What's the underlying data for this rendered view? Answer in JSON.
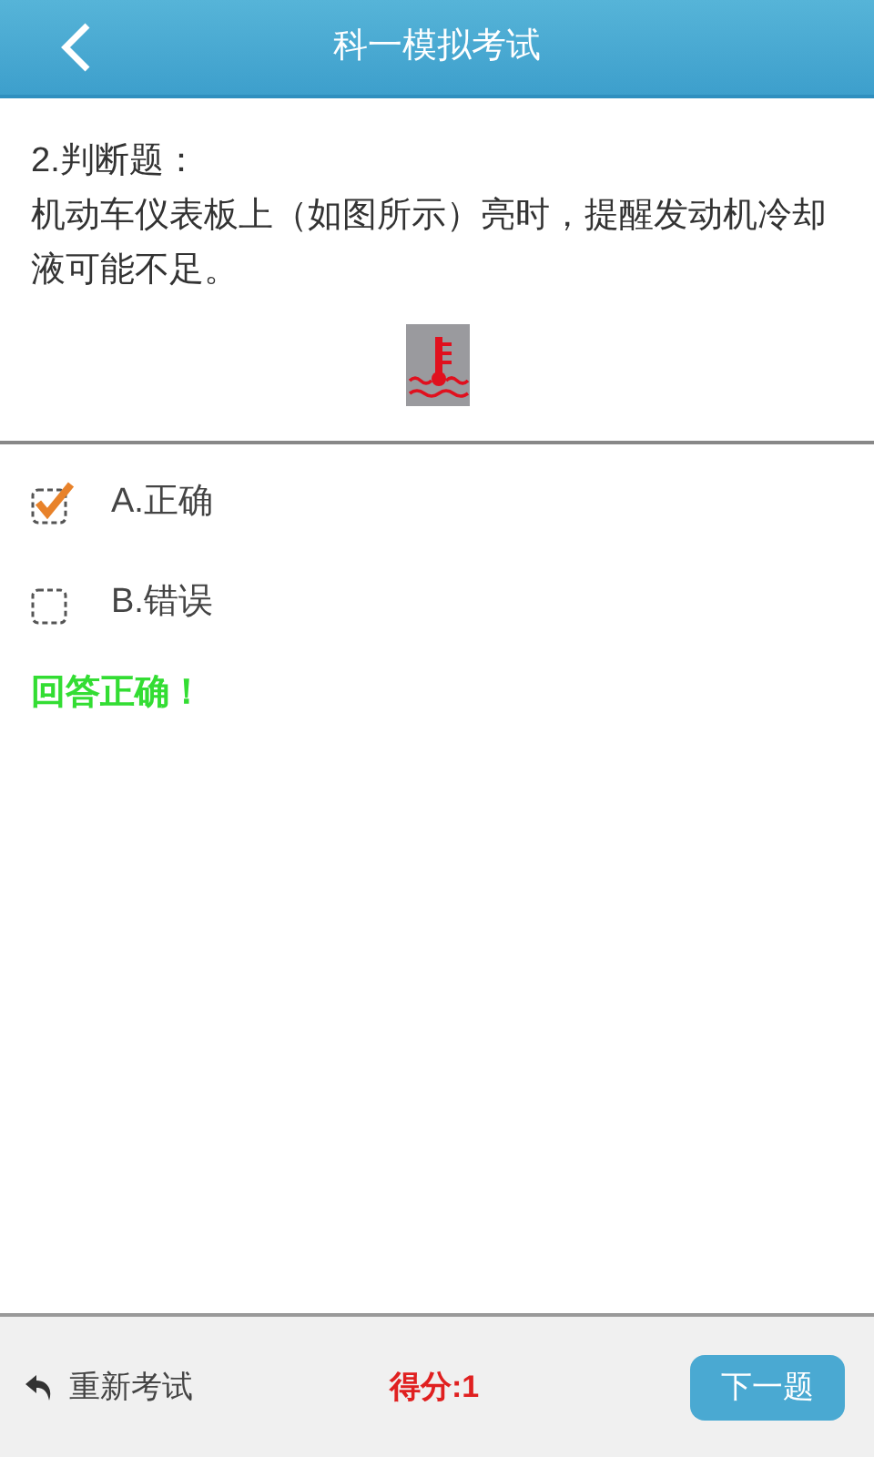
{
  "header": {
    "title": "科一模拟考试"
  },
  "question": {
    "type_label": "2.判断题：",
    "text": "机动车仪表板上（如图所示）亮时，提醒发动机冷却液可能不足。"
  },
  "options": [
    {
      "label": "A.正确",
      "checked": true
    },
    {
      "label": "B.错误",
      "checked": false
    }
  ],
  "feedback": "回答正确！",
  "footer": {
    "restart": "重新考试",
    "score": "得分:1",
    "next": "下一题"
  }
}
